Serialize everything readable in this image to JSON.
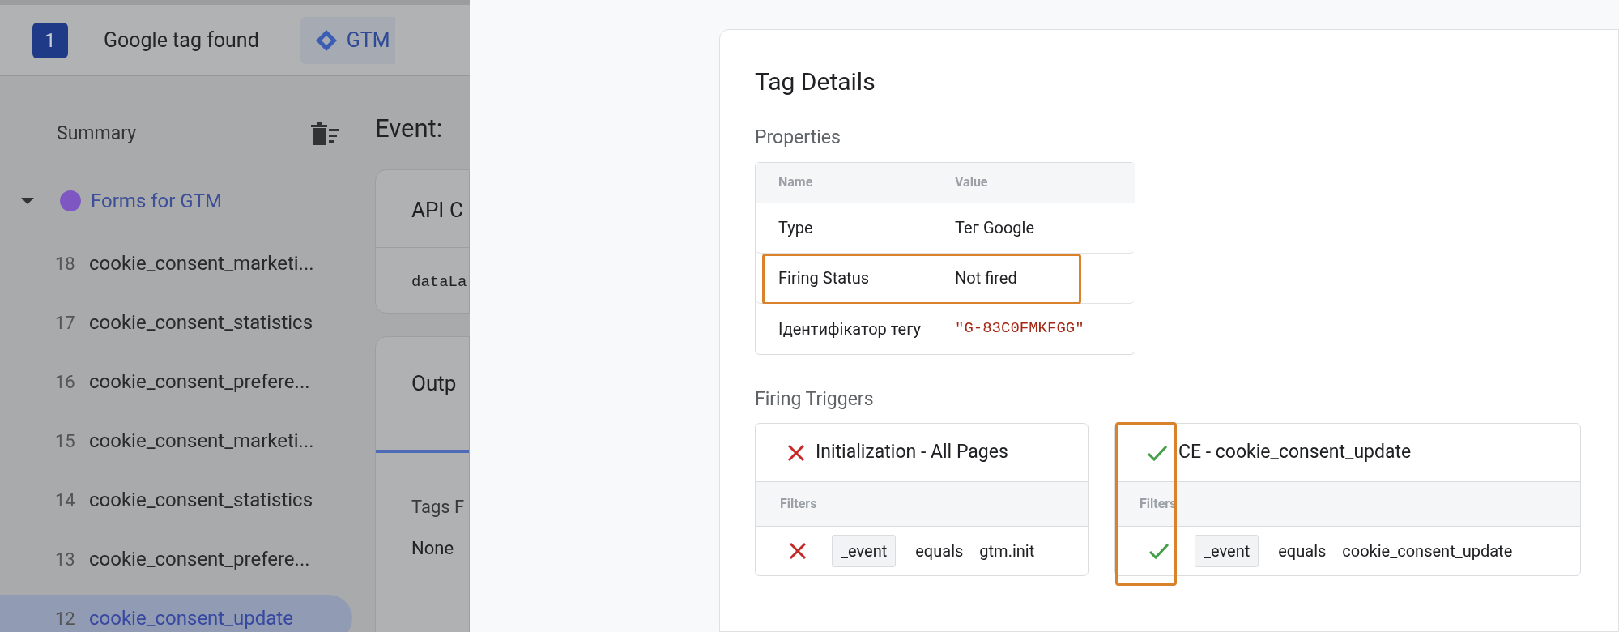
{
  "header": {
    "badge": "1",
    "title": "Google tag found",
    "chip": "GTM"
  },
  "sidebar": {
    "summary": "Summary",
    "group": {
      "label": "Forms for GTM",
      "color": "#7e57c2",
      "expanded": true,
      "items": [
        {
          "number": "18",
          "label": "cookie_consent_marketi...",
          "selected": false
        },
        {
          "number": "17",
          "label": "cookie_consent_statistics",
          "selected": false
        },
        {
          "number": "16",
          "label": "cookie_consent_prefere...",
          "selected": false
        },
        {
          "number": "15",
          "label": "cookie_consent_marketi...",
          "selected": false
        },
        {
          "number": "14",
          "label": "cookie_consent_statistics",
          "selected": false
        },
        {
          "number": "13",
          "label": "cookie_consent_prefere...",
          "selected": false
        },
        {
          "number": "12",
          "label": "cookie_consent_update",
          "selected": true
        }
      ]
    }
  },
  "main": {
    "title": "Event:",
    "api_card": {
      "title": "API C",
      "code": "dataLa"
    },
    "output_card": {
      "title": "Outp",
      "section": "Tags F",
      "value": "None"
    }
  },
  "tag_details": {
    "title": "Tag Details",
    "properties": {
      "heading": "Properties",
      "columns": [
        "Name",
        "Value"
      ],
      "rows": [
        {
          "name": "Type",
          "value": "Тег Google",
          "kind": "text",
          "highlighted": false
        },
        {
          "name": "Firing Status",
          "value": "Not fired",
          "kind": "text",
          "highlighted": true
        },
        {
          "name": "Ідентифікатор тегу",
          "value": "\"G-83C0FMKFGG\"",
          "kind": "code",
          "highlighted": false
        }
      ]
    },
    "triggers": {
      "heading": "Firing Triggers",
      "items": [
        {
          "name": "Initialization - All Pages",
          "fired": false,
          "highlighted": false,
          "filters_label": "Filters",
          "filters": [
            {
              "variable": "_event",
              "operator": "equals",
              "value": "gtm.init",
              "passed": false
            }
          ]
        },
        {
          "name": "CE - cookie_consent_update",
          "fired": true,
          "highlighted": true,
          "filters_label": "Filters",
          "filters": [
            {
              "variable": "_event",
              "operator": "equals",
              "value": "cookie_consent_update",
              "passed": true
            }
          ]
        }
      ]
    }
  }
}
